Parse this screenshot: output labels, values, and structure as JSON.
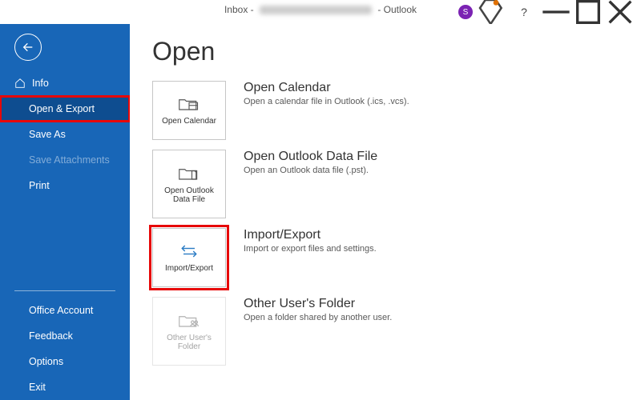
{
  "titlebar": {
    "prefix": "Inbox -",
    "suffix": "- Outlook",
    "avatar_initial": "S"
  },
  "sidebar": {
    "info": "Info",
    "open_export": "Open & Export",
    "save_as": "Save As",
    "save_attachments": "Save Attachments",
    "print": "Print",
    "office_account": "Office Account",
    "feedback": "Feedback",
    "options": "Options",
    "exit": "Exit"
  },
  "page": {
    "title": "Open",
    "items": [
      {
        "icon_name": "calendar",
        "tile_label": "Open Calendar",
        "heading": "Open Calendar",
        "desc": "Open a calendar file in Outlook (.ics, .vcs).",
        "highlight": false,
        "disabled": false
      },
      {
        "icon_name": "datafile",
        "tile_label": "Open Outlook Data File",
        "heading": "Open Outlook Data File",
        "desc": "Open an Outlook data file (.pst).",
        "highlight": false,
        "disabled": false
      },
      {
        "icon_name": "import-export",
        "tile_label": "Import/Export",
        "heading": "Import/Export",
        "desc": "Import or export files and settings.",
        "highlight": true,
        "disabled": false
      },
      {
        "icon_name": "other-user",
        "tile_label": "Other User's Folder",
        "heading": "Other User's Folder",
        "desc": "Open a folder shared by another user.",
        "highlight": false,
        "disabled": true
      }
    ]
  }
}
